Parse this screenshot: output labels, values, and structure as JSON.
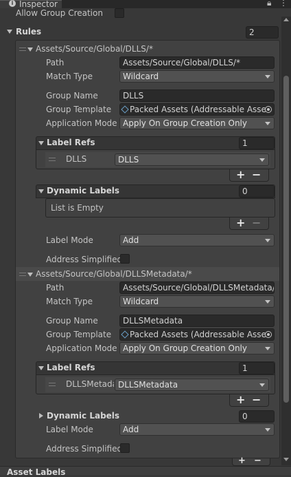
{
  "window": {
    "tab_title": "Inspector",
    "tab_icon": "info-icon",
    "lock_icon": "lock-icon",
    "menu_icon": "kebab-menu-icon"
  },
  "top": {
    "allow_group_creation_label": "Allow Group Creation",
    "allow_group_creation_checked": false
  },
  "rules": {
    "label": "Rules",
    "count": "2",
    "items": [
      {
        "header": "Assets/Source/Global/DLLS/*",
        "path_label": "Path",
        "path_value": "Assets/Source/Global/DLLS/*",
        "match_type_label": "Match Type",
        "match_type_value": "Wildcard",
        "group_name_label": "Group Name",
        "group_name_value": "DLLS",
        "group_template_label": "Group Template",
        "group_template_value": "Packed Assets (Addressable Asse",
        "application_mode_label": "Application Mode",
        "application_mode_value": "Apply On Group Creation Only",
        "label_refs_label": "Label Refs",
        "label_refs_count": "1",
        "label_refs_items": [
          {
            "key": "DLLS",
            "value": "DLLS"
          }
        ],
        "dynamic_labels_label": "Dynamic Labels",
        "dynamic_labels_count": "0",
        "dynamic_labels_empty": "List is Empty",
        "label_mode_label": "Label Mode",
        "label_mode_value": "Add",
        "address_simplified_label": "Address Simplified",
        "address_simplified_checked": false
      },
      {
        "header": "Assets/Source/Global/DLLSMetadata/*",
        "path_label": "Path",
        "path_value": "Assets/Source/Global/DLLSMetadata/*",
        "match_type_label": "Match Type",
        "match_type_value": "Wildcard",
        "group_name_label": "Group Name",
        "group_name_value": "DLLSMetadata",
        "group_template_label": "Group Template",
        "group_template_value": "Packed Assets (Addressable Asse",
        "application_mode_label": "Application Mode",
        "application_mode_value": "Apply On Group Creation Only",
        "label_refs_label": "Label Refs",
        "label_refs_count": "1",
        "label_refs_items": [
          {
            "key": "DLLSMetada",
            "value": "DLLSMetadata"
          }
        ],
        "dynamic_labels_label": "Dynamic Labels",
        "dynamic_labels_count": "0",
        "label_mode_label": "Label Mode",
        "label_mode_value": "Add",
        "address_simplified_label": "Address Simplified",
        "address_simplified_checked": false
      }
    ]
  },
  "buttons": {
    "plus": "+",
    "minus": "−"
  },
  "bottom": {
    "asset_labels": "Asset Labels"
  }
}
